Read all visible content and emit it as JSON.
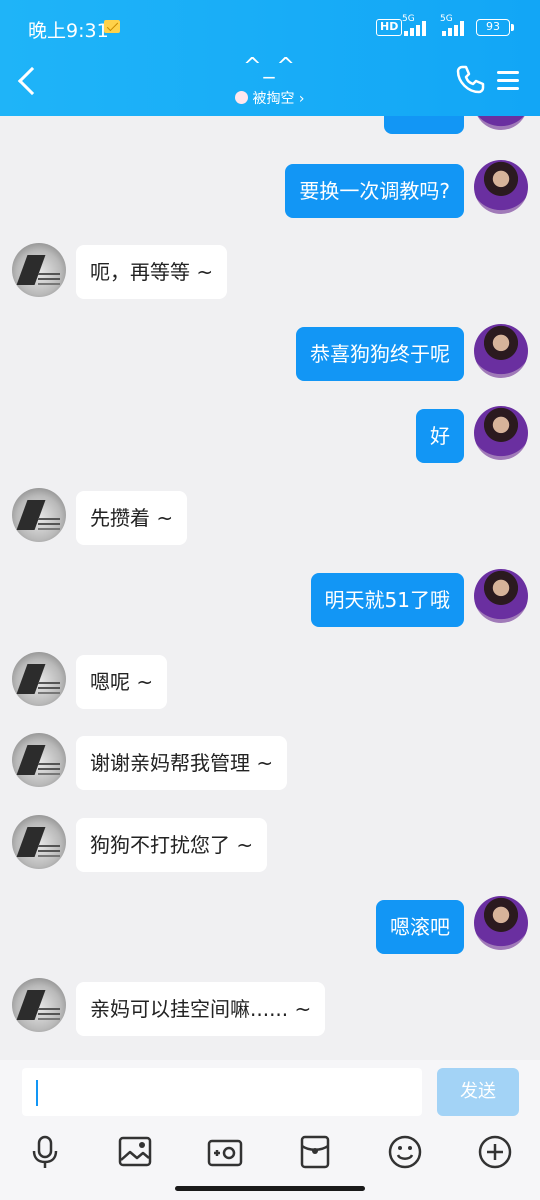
{
  "status": {
    "time": "晚上9:31",
    "hd": "HD",
    "net1": "5G",
    "net2": "5G",
    "battery": "93"
  },
  "header": {
    "title": "^_^",
    "subtitle": "被掏空",
    "subtitle_chevron": "›"
  },
  "messages": [
    {
      "side": "me",
      "text": "要换一次调教吗?"
    },
    {
      "side": "other",
      "text": "呃，再等等 ~"
    },
    {
      "side": "me",
      "text": "恭喜狗狗终于呢"
    },
    {
      "side": "me",
      "text": "好"
    },
    {
      "side": "other",
      "text": "先攒着 ~"
    },
    {
      "side": "me",
      "text": "明天就51了哦"
    },
    {
      "side": "other",
      "text": "嗯呢 ~"
    },
    {
      "side": "other",
      "text": "谢谢亲妈帮我管理 ~"
    },
    {
      "side": "other",
      "text": "狗狗不打扰您了 ~"
    },
    {
      "side": "me",
      "text": "嗯滚吧"
    },
    {
      "side": "other",
      "text": "亲妈可以挂空间嘛...... ~"
    }
  ],
  "input": {
    "value": "",
    "send_label": "发送"
  },
  "toolbar": [
    "mic-icon",
    "image-icon",
    "camera-icon",
    "red-packet-icon",
    "emoji-icon",
    "plus-icon"
  ]
}
